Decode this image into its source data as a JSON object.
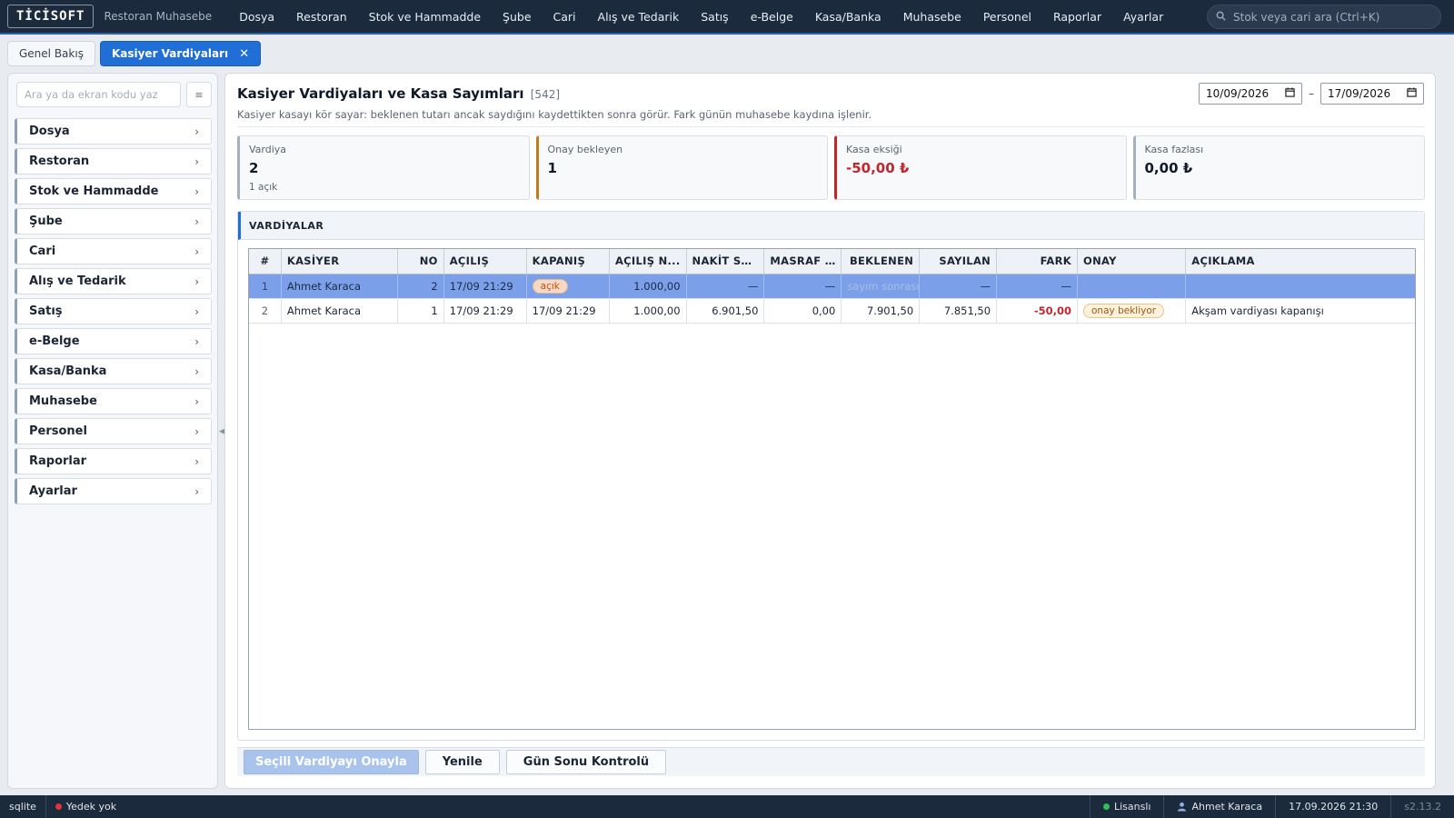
{
  "app": {
    "logo": "TİCİSOFT",
    "subtitle": "Restoran Muhasebe",
    "nav": [
      "Dosya",
      "Restoran",
      "Stok ve Hammadde",
      "Şube",
      "Cari",
      "Alış ve Tedarik",
      "Satış",
      "e-Belge",
      "Kasa/Banka",
      "Muhasebe",
      "Personel",
      "Raporlar",
      "Ayarlar"
    ],
    "search_placeholder": "Stok veya cari ara (Ctrl+K)"
  },
  "tabs": {
    "overview": "Genel Bakış",
    "active": "Kasiyer Vardiyaları",
    "close": "✕"
  },
  "sidebar": {
    "search_placeholder": "Ara ya da ekran kodu yaz",
    "grid_icon": "≡",
    "items": [
      "Dosya",
      "Restoran",
      "Stok ve Hammadde",
      "Şube",
      "Cari",
      "Alış ve Tedarik",
      "Satış",
      "e-Belge",
      "Kasa/Banka",
      "Muhasebe",
      "Personel",
      "Raporlar",
      "Ayarlar"
    ],
    "chevron": "›"
  },
  "page": {
    "title": "Kasiyer Vardiyaları ve Kasa Sayımları",
    "count": "[542]",
    "description": "Kasiyer kasayı kör sayar: beklenen tutarı ancak saydığını kaydettikten sonra görür. Fark günün muhasebe kaydına işlenir.",
    "date_from": "10/09/2026",
    "date_to": "17/09/2026",
    "date_sep": "–"
  },
  "kpis": {
    "shifts": {
      "label": "Vardiya",
      "value": "2",
      "sub": "1 açık"
    },
    "pending": {
      "label": "Onay bekleyen",
      "value": "1"
    },
    "shortage": {
      "label": "Kasa eksiği",
      "value": "-50,00 ₺"
    },
    "surplus": {
      "label": "Kasa fazlası",
      "value": "0,00 ₺"
    }
  },
  "section": {
    "title": "VARDİYALAR",
    "columns": [
      "#",
      "KASİYER",
      "NO",
      "AÇILIŞ",
      "KAPANIŞ",
      "AÇILIŞ N...",
      "NAKİT SA...",
      "MASRAF ...",
      "BEKLENEN",
      "SAYILAN",
      "FARK",
      "ONAY",
      "AÇIKLAMA"
    ],
    "rows": [
      {
        "idx": "1",
        "cashier": "Ahmet Karaca",
        "no": "2",
        "opened": "17/09 21:29",
        "closed": "açık",
        "opening": "1.000,00",
        "cash_sales": "—",
        "expense": "—",
        "expected": "sayım sonrası",
        "counted": "—",
        "diff": "—",
        "approval": "",
        "note": ""
      },
      {
        "idx": "2",
        "cashier": "Ahmet Karaca",
        "no": "1",
        "opened": "17/09 21:29",
        "closed": "17/09 21:29",
        "opening": "1.000,00",
        "cash_sales": "6.901,50",
        "expense": "0,00",
        "expected": "7.901,50",
        "counted": "7.851,50",
        "diff": "-50,00",
        "approval": "onay bekliyor",
        "note": "Akşam vardiyası kapanışı"
      }
    ]
  },
  "buttons": {
    "approve": "Seçili Vardiyayı Onayla",
    "refresh": "Yenile",
    "eod": "Gün Sonu Kontrolü"
  },
  "status": {
    "db": "sqlite",
    "backup": "Yedek yok",
    "license": "Lisanslı",
    "user": "Ahmet Karaca",
    "datetime": "17.09.2026 21:30",
    "version": "s2.13.2"
  },
  "colors": {
    "accent": "#1f6fd6",
    "topbar": "#1c2a3d",
    "negative": "#c0272d",
    "warning": "#c07a1a",
    "selected_row": "#7b9fe8"
  },
  "icons": {
    "search": "search-icon",
    "calendar": "calendar-icon",
    "user": "user-icon"
  }
}
